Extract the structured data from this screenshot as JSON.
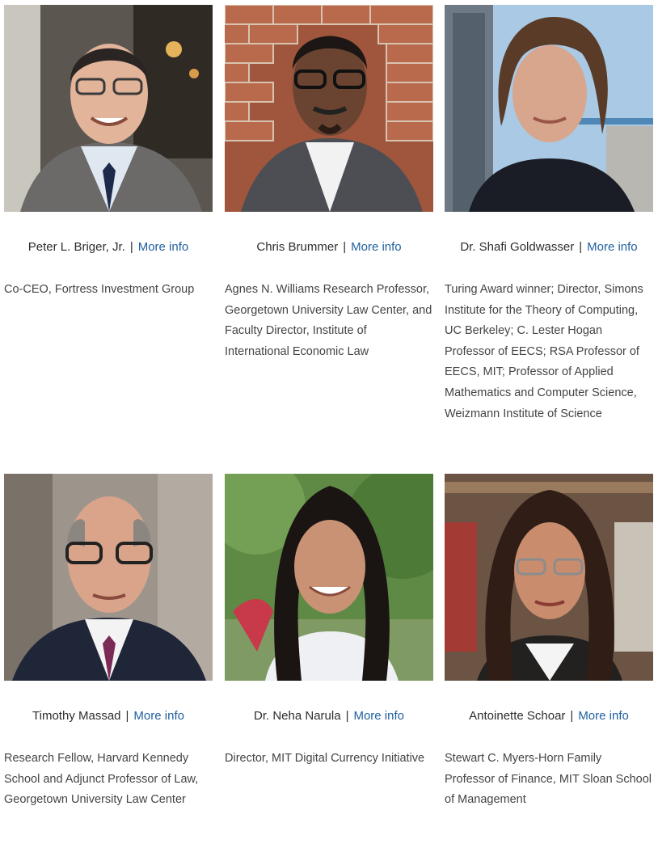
{
  "people": [
    {
      "name": "Peter L. Briger, Jr.",
      "separator": "|",
      "link_label": "More info",
      "description": "Co-CEO, Fortress Investment Group"
    },
    {
      "name": "Chris Brummer",
      "separator": "|",
      "link_label": "More info",
      "description": "Agnes N. Williams Research Professor, Georgetown University Law Center, and Faculty Director, Institute of International Economic Law"
    },
    {
      "name": "Dr. Shafi Goldwasser",
      "separator": "|",
      "link_label": "More info",
      "description": "Turing Award winner; Director, Simons Institute for the Theory of Computing, UC Berkeley; C. Lester Hogan Professor of EECS; RSA Professor of EECS, MIT; Professor of Applied Mathematics and Computer Science, Weizmann Institute of Science"
    },
    {
      "name": "Timothy Massad",
      "separator": "|",
      "link_label": "More info",
      "description": "Research Fellow, Harvard Kennedy School and Adjunct Professor of Law, Georgetown University Law Center"
    },
    {
      "name": "Dr. Neha Narula",
      "separator": "|",
      "link_label": "More info",
      "description": "Director, MIT Digital Currency Initiative"
    },
    {
      "name": "Antoinette Schoar",
      "separator": "|",
      "link_label": "More info",
      "description": "Stewart C. Myers-Horn Family Professor of Finance, MIT Sloan School of Management"
    }
  ],
  "colors": {
    "link": "#1f5f9e",
    "text": "#444444"
  }
}
